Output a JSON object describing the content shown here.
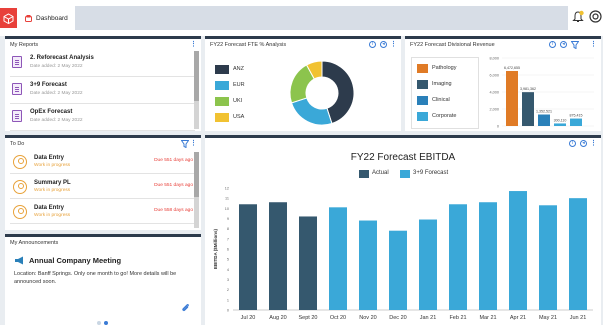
{
  "header": {
    "tab_label": "Dashboard",
    "bell_badge": "1"
  },
  "colors": {
    "dark_navy": "#2d3b4c",
    "actual": "#35586e",
    "forecast": "#3aa8d8",
    "orange": "#e07b26",
    "brand_red": "#e8403a",
    "yellow": "#f1c232",
    "green": "#8cc44d",
    "blue": "#2a80b9"
  },
  "my_reports": {
    "title": "My Reports",
    "items": [
      {
        "title": "2. Reforecast Analysis",
        "date": "Date added: 2 May 2022"
      },
      {
        "title": "3+9 Forecast",
        "date": "Date added: 2 May 2022"
      },
      {
        "title": "OpEx Forecast",
        "date": "Date added: 2 May 2022"
      }
    ]
  },
  "todo": {
    "title": "To Do",
    "items": [
      {
        "title": "Data Entry",
        "status": "Work in progress",
        "due": "Due 551 days ago"
      },
      {
        "title": "Summary PL",
        "status": "Work in progress",
        "due": "Due 551 days ago"
      },
      {
        "title": "Data Entry",
        "status": "Work in progress",
        "due": "Due 558 days ago"
      }
    ]
  },
  "announcements": {
    "title": "My Announcements",
    "headline": "Annual Company Meeting",
    "body": "Location: Banff Springs. Only one month to go! More details will be announced soon."
  },
  "fte_chart": {
    "title": "FY22 Forecast FTE % Analysis",
    "chart_data": {
      "type": "pie",
      "categories": [
        "ANZ",
        "EUR",
        "UKI",
        "USA"
      ],
      "colors": [
        "#2d3b4c",
        "#3aa8d8",
        "#8cc44d",
        "#f1c232"
      ],
      "values": [
        45,
        25,
        22,
        8
      ]
    }
  },
  "revenue_chart": {
    "title": "FY22 Forecast Divisional Revenue",
    "chart_data": {
      "type": "bar",
      "categories": [
        "Pathology",
        "Imaging",
        "Clinical",
        "Corporate"
      ],
      "colors": [
        "#e07b26",
        "#35586e",
        "#2a80b9",
        "#3aa8d8"
      ],
      "values": [
        6472655,
        3981362,
        1352521,
        300110,
        875415
      ],
      "value_labels": [
        "6,472,655",
        "3,981,362",
        "1,352,521",
        "300,110",
        "875,415"
      ],
      "ylim": [
        0,
        8000000
      ],
      "y_ticks": [
        "8,000",
        "6,000",
        "4,000",
        "2,000",
        "0"
      ]
    }
  },
  "ebitda_chart": {
    "chart_data": {
      "type": "bar",
      "title": "FY22 Forecast EBITDA",
      "ylabel": "EBITDA ($Millions)",
      "categories": [
        "Jul 20",
        "Aug 20",
        "Sept 20",
        "Oct 20",
        "Nov 20",
        "Dec 20",
        "Jan 21",
        "Feb 21",
        "Mar 21",
        "Apr 21",
        "May 21",
        "Jun 21"
      ],
      "series": [
        {
          "name": "Actual",
          "values": [
            10.4,
            10.6,
            9.2,
            null,
            null,
            null,
            null,
            null,
            null,
            null,
            null,
            null
          ]
        },
        {
          "name": "3+9 Forecast",
          "values": [
            null,
            null,
            null,
            10.1,
            8.8,
            7.8,
            8.9,
            10.4,
            10.6,
            11.7,
            10.3,
            11.0
          ]
        }
      ],
      "ylim": [
        0,
        12
      ],
      "y_ticks": [
        "0",
        "1",
        "2",
        "3",
        "4",
        "5",
        "6",
        "7",
        "8",
        "9",
        "10",
        "11",
        "12"
      ]
    }
  }
}
